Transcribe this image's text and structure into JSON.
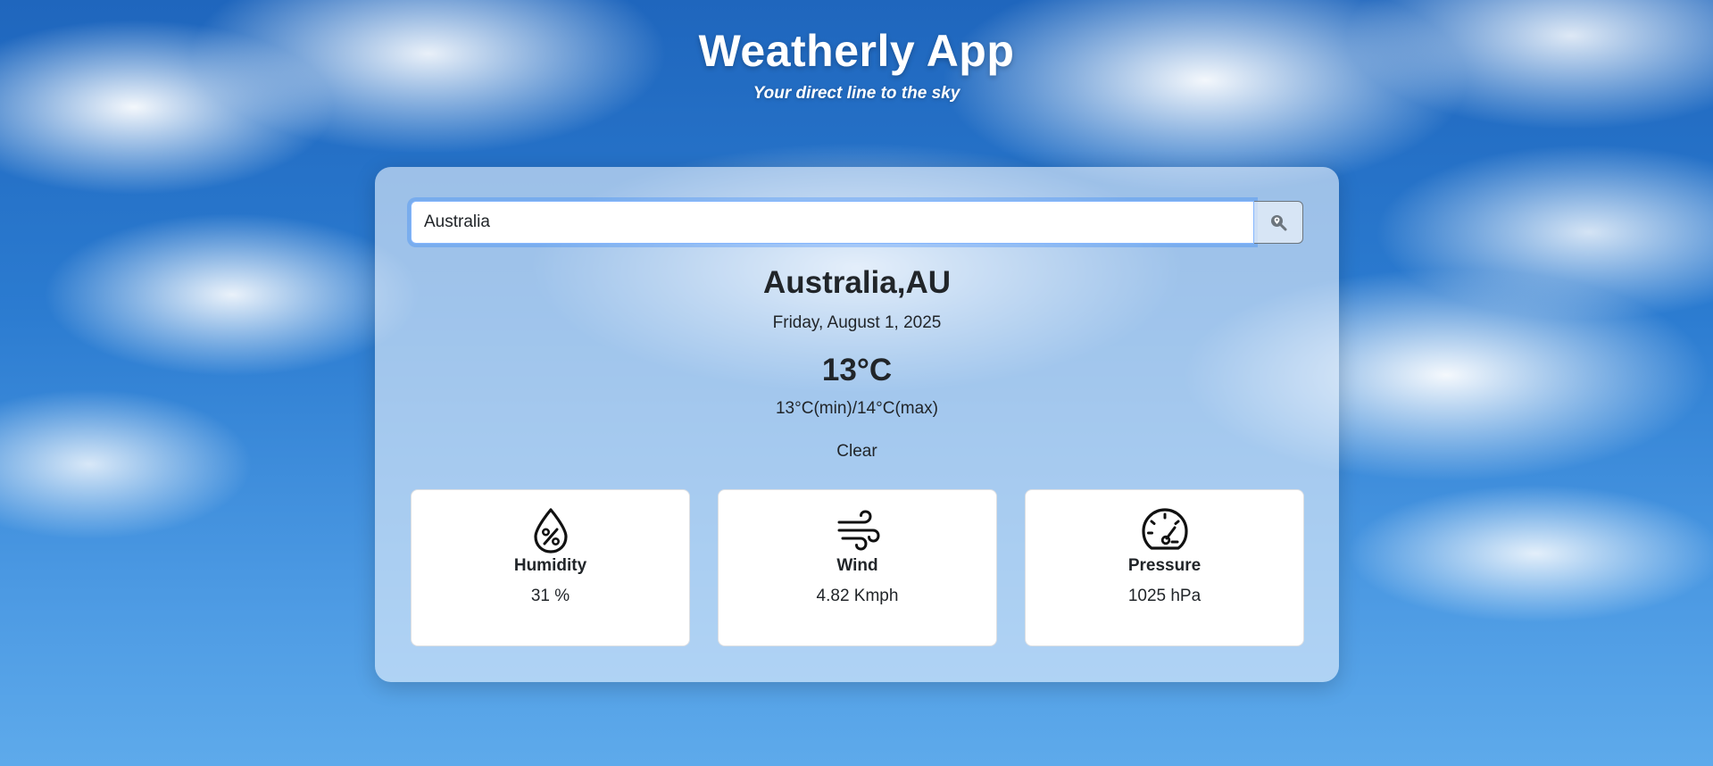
{
  "header": {
    "title": "Weatherly App",
    "subtitle": "Your direct line to the sky"
  },
  "search": {
    "value": "Australia",
    "button_icon": "search-location-icon"
  },
  "weather": {
    "location": "Australia,AU",
    "date": "Friday, August 1, 2025",
    "temperature": "13°C",
    "min_max": "13°C(min)/14°C(max)",
    "condition": "Clear"
  },
  "stats": {
    "humidity": {
      "label": "Humidity",
      "value": "31 %",
      "icon": "humidity-drop-icon"
    },
    "wind": {
      "label": "Wind",
      "value": "4.82 Kmph",
      "icon": "wind-icon"
    },
    "pressure": {
      "label": "Pressure",
      "value": "1025 hPa",
      "icon": "gauge-icon"
    }
  },
  "colors": {
    "sky_blue": "#2b7bd0",
    "focus_ring": "#86b7fe",
    "text_dark": "#212529"
  }
}
